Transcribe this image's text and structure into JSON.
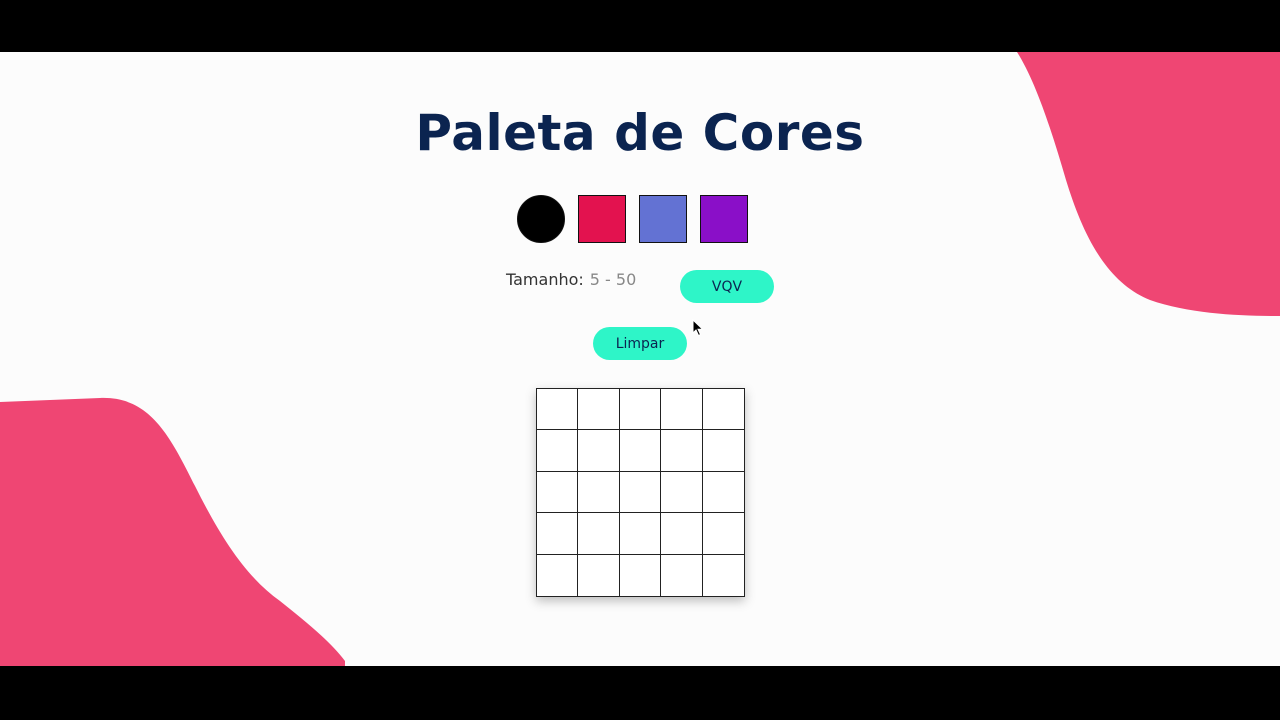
{
  "page": {
    "title": "Paleta de Cores",
    "background_color": "#fcfcfc",
    "accent_blob_color": "#ef4673",
    "title_color": "#0b2450"
  },
  "palette": {
    "colors": [
      "#000000",
      "#e3124f",
      "#6372d3",
      "#8a0fc8"
    ],
    "selected_index": 0
  },
  "board_size": {
    "label": "Tamanho:",
    "input_value": "",
    "input_placeholder": "5 - 50",
    "apply_button_label": "VQV"
  },
  "clear_button_label": "Limpar",
  "pixel_board": {
    "rows": 5,
    "columns": 5,
    "cell_color": "#ffffff"
  }
}
